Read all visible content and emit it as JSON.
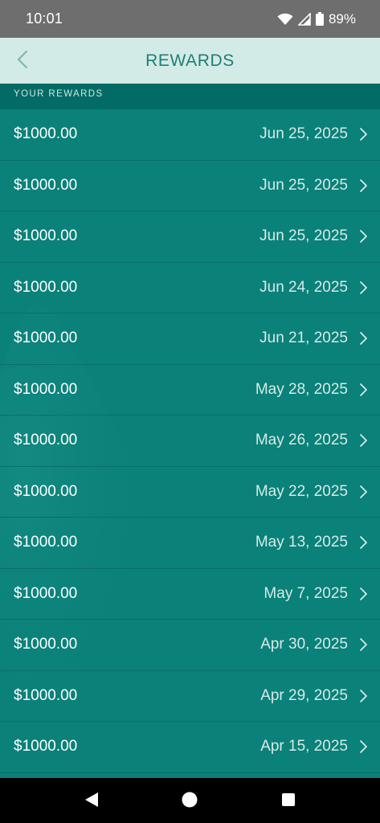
{
  "status_bar": {
    "time": "10:01",
    "battery": "89%",
    "icons": [
      "wifi-icon",
      "signal-icon",
      "battery-icon"
    ]
  },
  "header": {
    "title": "REWARDS",
    "back_icon": "chevron-left-icon"
  },
  "section": {
    "label": "YOUR REWARDS"
  },
  "rewards": [
    {
      "amount": "$1000.00",
      "date": "Jun 25, 2025"
    },
    {
      "amount": "$1000.00",
      "date": "Jun 25, 2025"
    },
    {
      "amount": "$1000.00",
      "date": "Jun 25, 2025"
    },
    {
      "amount": "$1000.00",
      "date": "Jun 24, 2025"
    },
    {
      "amount": "$1000.00",
      "date": "Jun 21, 2025"
    },
    {
      "amount": "$1000.00",
      "date": "May 28, 2025"
    },
    {
      "amount": "$1000.00",
      "date": "May 26, 2025"
    },
    {
      "amount": "$1000.00",
      "date": "May 22, 2025"
    },
    {
      "amount": "$1000.00",
      "date": "May 13, 2025"
    },
    {
      "amount": "$1000.00",
      "date": "May 7, 2025"
    },
    {
      "amount": "$1000.00",
      "date": "Apr 30, 2025"
    },
    {
      "amount": "$1000.00",
      "date": "Apr 29, 2025"
    },
    {
      "amount": "$1000.00",
      "date": "Apr 15, 2025"
    }
  ],
  "nav_bar": {
    "buttons": [
      "back-triangle-icon",
      "home-circle-icon",
      "recents-square-icon"
    ]
  },
  "colors": {
    "status_bar": "#6e6e6e",
    "header_bg": "#d3ebe7",
    "header_text": "#1f7e76",
    "section_bg": "#036b65",
    "list_bg": "#0a8179",
    "divider": "#0a6f68"
  }
}
